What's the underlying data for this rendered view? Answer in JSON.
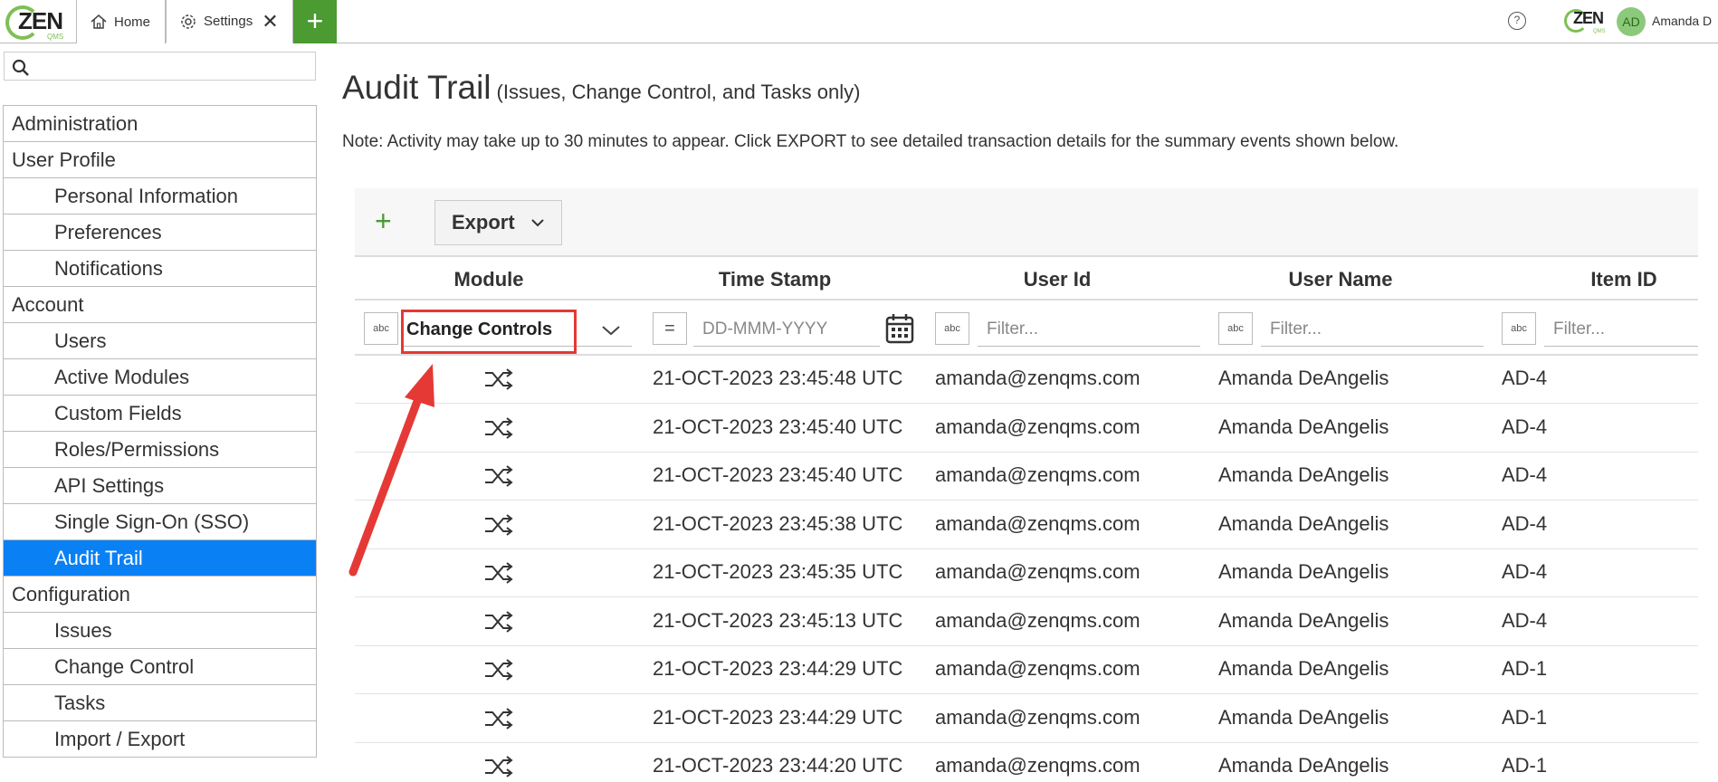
{
  "topbar": {
    "logo": {
      "text": "ZEN",
      "sub": "QMS"
    },
    "tabs": [
      {
        "label": "Home",
        "icon": "home-icon"
      },
      {
        "label": "Settings",
        "icon": "gear-icon",
        "close": "✕"
      }
    ],
    "add_tab": "+",
    "help": "?",
    "user_initials": "AD",
    "user_name": "Amanda D"
  },
  "sidebar": {
    "search_placeholder": "",
    "items": [
      {
        "label": "Administration"
      },
      {
        "label": "User Profile"
      },
      {
        "label": "Personal Information"
      },
      {
        "label": "Preferences"
      },
      {
        "label": "Notifications"
      },
      {
        "label": "Account"
      },
      {
        "label": "Users"
      },
      {
        "label": "Active Modules"
      },
      {
        "label": "Custom Fields"
      },
      {
        "label": "Roles/Permissions"
      },
      {
        "label": "API Settings"
      },
      {
        "label": "Single Sign-On (SSO)"
      },
      {
        "label": "Audit Trail"
      },
      {
        "label": "Configuration"
      },
      {
        "label": "Issues"
      },
      {
        "label": "Change Control"
      },
      {
        "label": "Tasks"
      },
      {
        "label": "Import / Export"
      }
    ]
  },
  "main": {
    "title": "Audit Trail",
    "subtitle": "(Issues, Change Control, and Tasks only)",
    "note": "Note: Activity may take up to 30 minutes to appear. Click EXPORT to see detailed transaction details for the summary events shown below.",
    "toolbar": {
      "add": "+",
      "export_label": "Export"
    },
    "columns": [
      "Module",
      "Time Stamp",
      "User Id",
      "User Name",
      "Item ID"
    ],
    "filters": {
      "module_value": "Change Controls",
      "timestamp_placeholder": "DD-MMM-YYYY",
      "userid_placeholder": "Filter...",
      "username_placeholder": "Filter...",
      "itemid_placeholder": "Filter...",
      "text_filter_icon": "abc",
      "equals_icon": "="
    },
    "rows": [
      {
        "timestamp": "21-OCT-2023 23:45:48 UTC",
        "user_id": "amanda@zenqms.com",
        "user_name": "Amanda DeAngelis",
        "item_id": "AD-4"
      },
      {
        "timestamp": "21-OCT-2023 23:45:40 UTC",
        "user_id": "amanda@zenqms.com",
        "user_name": "Amanda DeAngelis",
        "item_id": "AD-4"
      },
      {
        "timestamp": "21-OCT-2023 23:45:40 UTC",
        "user_id": "amanda@zenqms.com",
        "user_name": "Amanda DeAngelis",
        "item_id": "AD-4"
      },
      {
        "timestamp": "21-OCT-2023 23:45:38 UTC",
        "user_id": "amanda@zenqms.com",
        "user_name": "Amanda DeAngelis",
        "item_id": "AD-4"
      },
      {
        "timestamp": "21-OCT-2023 23:45:35 UTC",
        "user_id": "amanda@zenqms.com",
        "user_name": "Amanda DeAngelis",
        "item_id": "AD-4"
      },
      {
        "timestamp": "21-OCT-2023 23:45:13 UTC",
        "user_id": "amanda@zenqms.com",
        "user_name": "Amanda DeAngelis",
        "item_id": "AD-4"
      },
      {
        "timestamp": "21-OCT-2023 23:44:29 UTC",
        "user_id": "amanda@zenqms.com",
        "user_name": "Amanda DeAngelis",
        "item_id": "AD-1"
      },
      {
        "timestamp": "21-OCT-2023 23:44:29 UTC",
        "user_id": "amanda@zenqms.com",
        "user_name": "Amanda DeAngelis",
        "item_id": "AD-1"
      },
      {
        "timestamp": "21-OCT-2023 23:44:20 UTC",
        "user_id": "amanda@zenqms.com",
        "user_name": "Amanda DeAngelis",
        "item_id": "AD-1"
      }
    ]
  },
  "colors": {
    "accent_green": "#4b9a32",
    "active_blue": "#0a80f5",
    "annotation_red": "#e53935"
  }
}
